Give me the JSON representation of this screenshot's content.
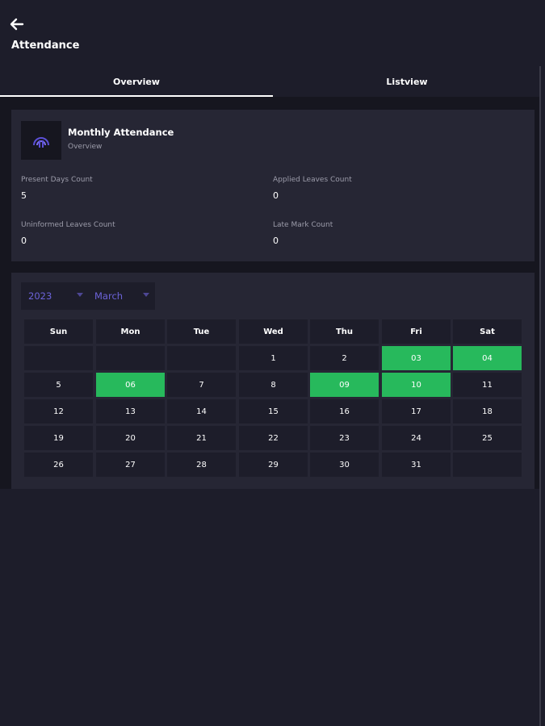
{
  "header": {
    "title": "Attendance"
  },
  "tabs": [
    {
      "label": "Overview"
    },
    {
      "label": "Listview"
    }
  ],
  "summary": {
    "title": "Monthly Attendance",
    "subtitle": "Overview",
    "stats": {
      "present": {
        "label": "Present Days Count",
        "value": "5"
      },
      "applied": {
        "label": "Applied Leaves Count",
        "value": "0"
      },
      "uninformed": {
        "label": "Uninformed Leaves Count",
        "value": "0"
      },
      "late": {
        "label": "Late Mark Count",
        "value": "0"
      }
    }
  },
  "calendar": {
    "year": "2023",
    "month": "March",
    "weekdays": [
      "Sun",
      "Mon",
      "Tue",
      "Wed",
      "Thu",
      "Fri",
      "Sat"
    ],
    "weeks": [
      [
        "",
        "",
        "",
        "1",
        "2",
        "03",
        "04"
      ],
      [
        "5",
        "06",
        "7",
        "8",
        "09",
        "10",
        "11"
      ],
      [
        "12",
        "13",
        "14",
        "15",
        "16",
        "17",
        "18"
      ],
      [
        "19",
        "20",
        "21",
        "22",
        "23",
        "24",
        "25"
      ],
      [
        "26",
        "27",
        "28",
        "29",
        "30",
        "31",
        ""
      ]
    ],
    "present_days": [
      "03",
      "04",
      "06",
      "09",
      "10"
    ]
  },
  "colors": {
    "background": "#1d1d2a",
    "card": "#262634",
    "present": "#27b95c",
    "accent": "#6c63d9"
  },
  "icons": {
    "back": "arrow-left-icon",
    "summary": "attendance-logo-icon"
  }
}
